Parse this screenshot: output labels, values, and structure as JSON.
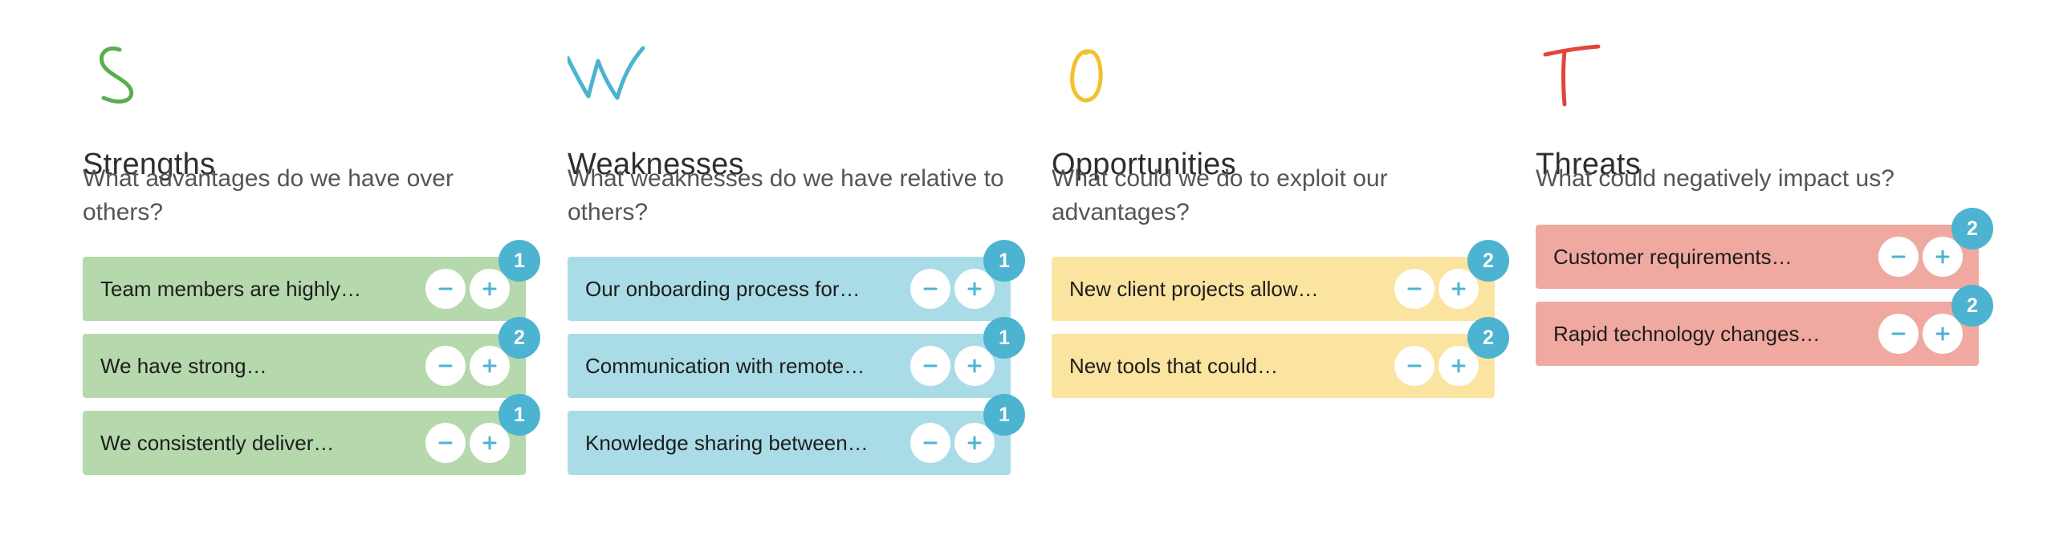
{
  "columns": [
    {
      "key": "strengths",
      "letter": "S",
      "letter_color": "#5aae52",
      "card_color": "#b5d8ac",
      "title": "Strengths",
      "question": "What advantages do we have over others?",
      "cards": [
        {
          "text": "Team members are highly…",
          "votes": "1"
        },
        {
          "text": "We have strong…",
          "votes": "2"
        },
        {
          "text": "We consistently deliver…",
          "votes": "1"
        }
      ]
    },
    {
      "key": "weaknesses",
      "letter": "W",
      "letter_color": "#4bb3cf",
      "card_color": "#a9dce6",
      "title": "Weaknesses",
      "question": "What weaknesses do we have relative to others?",
      "cards": [
        {
          "text": "Our onboarding process for…",
          "votes": "1"
        },
        {
          "text": "Communication with remote…",
          "votes": "1"
        },
        {
          "text": "Knowledge sharing between…",
          "votes": "1"
        }
      ]
    },
    {
      "key": "opportunities",
      "letter": "O",
      "letter_color": "#f2c12e",
      "card_color": "#fbe4a0",
      "title": "Opportunities",
      "question": "What could we do to exploit our advantages?",
      "cards": [
        {
          "text": "New client projects allow…",
          "votes": "2"
        },
        {
          "text": "New tools that could…",
          "votes": "2"
        }
      ]
    },
    {
      "key": "threats",
      "letter": "T",
      "letter_color": "#e0473a",
      "card_color": "#f0a9a0",
      "title": "Threats",
      "question": "What could negatively impact us?",
      "cards": [
        {
          "text": "Customer requirements…",
          "votes": "2"
        },
        {
          "text": "Rapid technology changes…",
          "votes": "2"
        }
      ]
    }
  ],
  "icons": {
    "decrement": "minus-icon",
    "increment": "plus-icon",
    "accent_color": "#4cb3d1"
  }
}
